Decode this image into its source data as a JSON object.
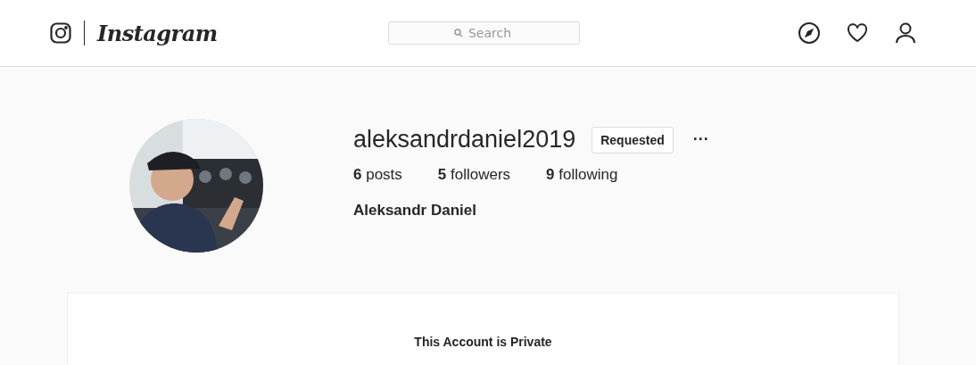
{
  "header": {
    "wordmark": "Instagram",
    "search": {
      "placeholder": "Search"
    }
  },
  "profile": {
    "username": "aleksandrdaniel2019",
    "follow_button": "Requested",
    "more": "···",
    "stats": [
      "**6** posts",
      "**5** followers",
      "**9** following"
    ],
    "full_name": "Aleksandr Daniel"
  },
  "private_notice": {
    "title": "This Account is Private"
  }
}
